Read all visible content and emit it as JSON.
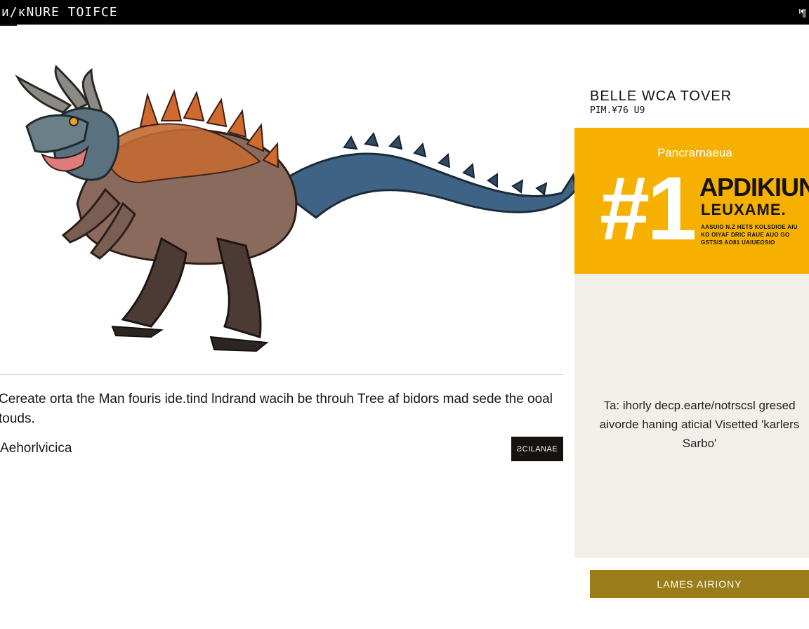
{
  "header": {
    "title": "ᴎ/ᴋNURE TOIFCE",
    "corner_label": "ᴵ¶"
  },
  "illustration": {
    "subject": "dinosaur-illustration"
  },
  "article": {
    "caption": "Cereate orta the Man fouris ide.tind lndrand wacih be throuh Tree af bidors mad sede the ooal touds.",
    "author": "Aehorlvicica",
    "action_label": "ƧCILANAE"
  },
  "sidebar": {
    "title": "BELLE WCA TOVER",
    "subtitle": "PIM.¥76 U9",
    "promo": {
      "kicker": "Pancrarnaeua",
      "rank": "#1",
      "headline": "APDIKIUN",
      "subheadline": "LEUXAME.",
      "fine_print": "AASUIO N.Z HETS KOLSDIOE AIU KO OIYAF DRIC RAUE AUO GO GSTSIS AO81 UAIUEOSIO"
    },
    "card_text": "Ta: ihorly decp.earte/notrscsl gresed aivorde haning aticial Visetted 'karlers Sarbo'",
    "cta_label": "LAMES AIRIONY"
  },
  "colors": {
    "topbar": "#000000",
    "promo": "#f6b100",
    "card": "#f2efe8",
    "cta": "#9a7d18"
  }
}
